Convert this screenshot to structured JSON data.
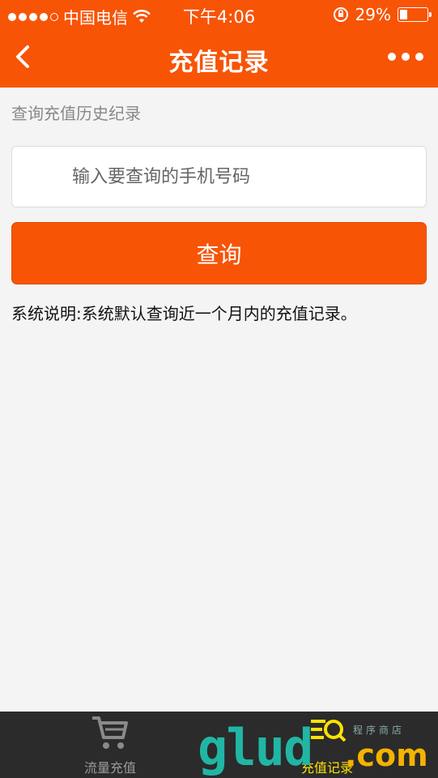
{
  "status_bar": {
    "carrier": "中国电信",
    "time": "下午4:06",
    "battery_percent": "29%",
    "signal_bars": 4,
    "battery_level": 0.29
  },
  "nav": {
    "title": "充值记录",
    "back_icon": "chevron-left-icon",
    "more_icon": "more-dots-icon"
  },
  "form": {
    "hint": "查询充值历史纪录",
    "phone_placeholder": "输入要查询的手机号码",
    "phone_value": "",
    "query_button": "查询",
    "note": "系统说明:系统默认查询近一个月内的充值记录。"
  },
  "tabbar": {
    "items": [
      {
        "label": "流量充值",
        "icon": "cart-icon",
        "active": false
      },
      {
        "label": "充值记录",
        "icon": "record-search-icon",
        "active": true
      }
    ]
  },
  "watermark": {
    "text": "glud",
    "suffix": ".com",
    "small_text": "程序商店"
  },
  "colors": {
    "accent": "#f75406",
    "tabbar_bg": "#2b2b2b",
    "tab_active": "#ffe100",
    "tab_inactive": "#9a9a9a",
    "page_bg": "#f4f4f4"
  }
}
